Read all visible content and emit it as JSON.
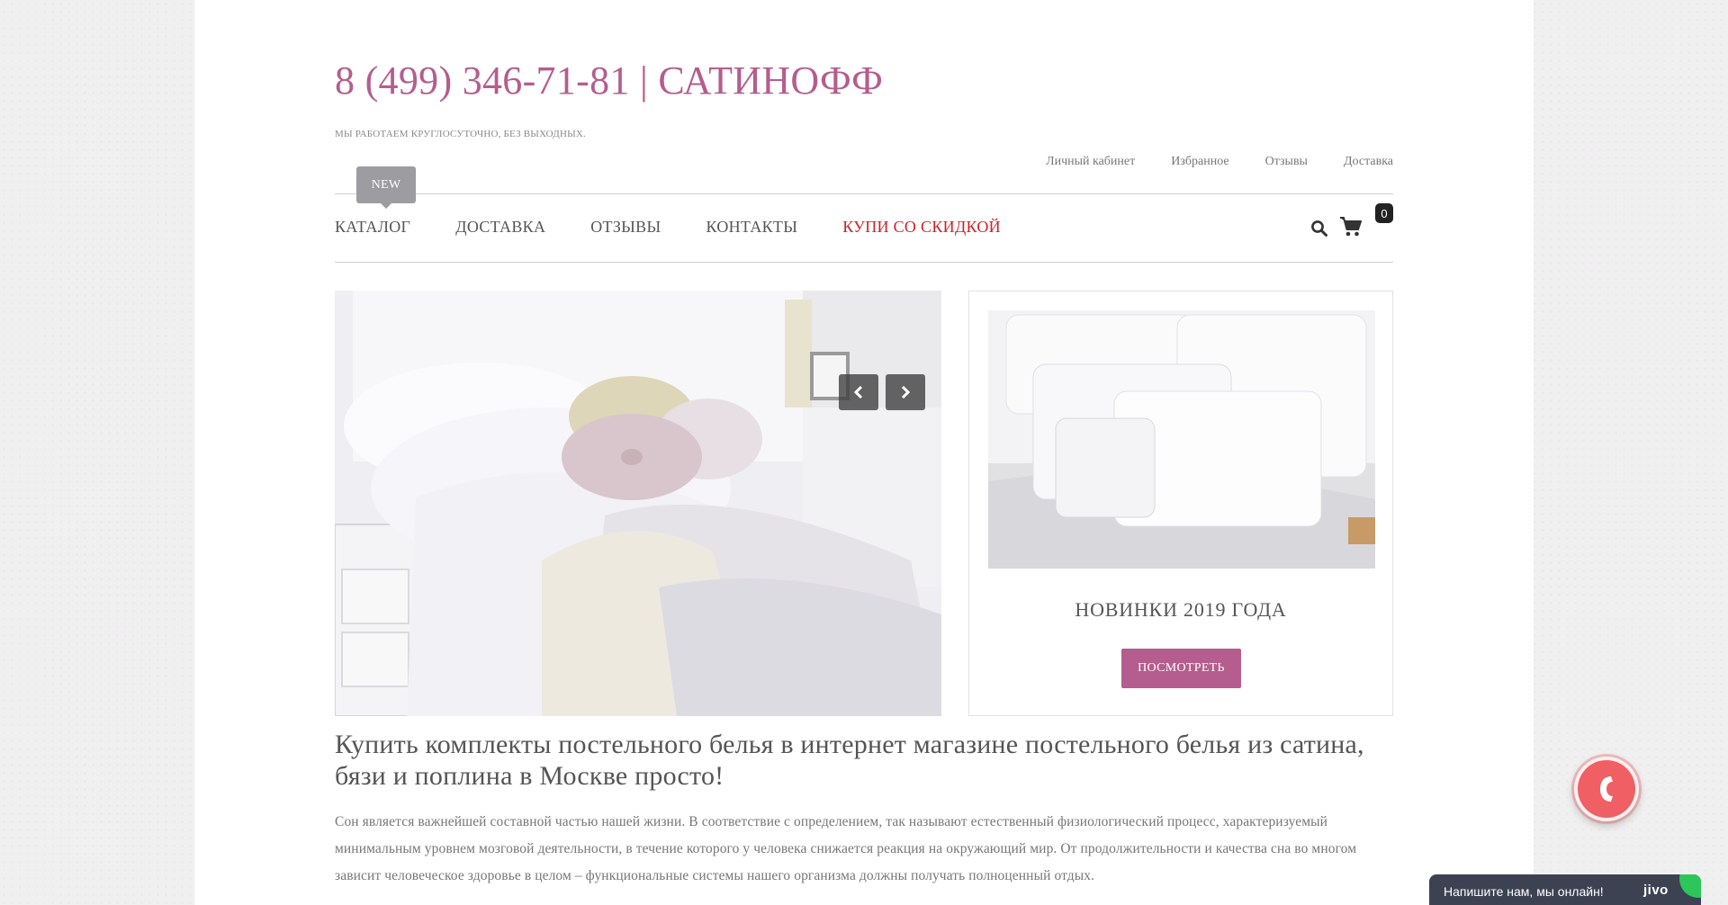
{
  "header": {
    "title": "8 (499) 346-71-81 | САТИНОФФ",
    "tagline": "МЫ РАБОТАЕМ КРУГЛОСУТОЧНО, БЕЗ ВЫХОДНЫХ."
  },
  "top_links": [
    "Личный кабинет",
    "Избранное",
    "Отзывы",
    "Доставка"
  ],
  "nav": {
    "badge": "NEW",
    "items": [
      "КАТАЛОГ",
      "ДОСТАВКА",
      "ОТЗЫВЫ",
      "КОНТАКТЫ"
    ],
    "sale_item": "КУПИ СО СКИДКОЙ",
    "search_icon": "search-icon",
    "cart_icon": "cart-icon",
    "cart_count": "0"
  },
  "slider": {
    "image": "bedroom-bedding-photo",
    "prev_icon": "chevron-left-icon",
    "next_icon": "chevron-right-icon"
  },
  "promo": {
    "image": "white-bedding-photo",
    "title": "НОВИНКИ 2019 ГОДА",
    "button_label": "ПОСМОТРЕТЬ"
  },
  "content": {
    "headline": "Купить комплекты постельного белья в интернет магазине постельного белья из сатина, бязи и поплина в Москве просто!",
    "intro": "Сон является важнейшей составной частью нашей жизни. В соответствие с определением, так называют естественный физиологический процесс, характеризуемый минимальным уровнем мозговой деятельности, в течение которого у человека снижается реакция на окружающий мир. От продолжительности и качества сна во многом зависит человеческое здоровье в целом – функциональные системы нашего организма должны получать полноценный отдых."
  },
  "widgets": {
    "call_icon": "phone-icon",
    "chat_text": "Напишите нам, мы онлайн!",
    "chat_logo": "jivo"
  },
  "colors": {
    "brand": "#b45d8e",
    "sale": "#d22028",
    "call": "#ef5f63",
    "chat": "#3d4253"
  }
}
